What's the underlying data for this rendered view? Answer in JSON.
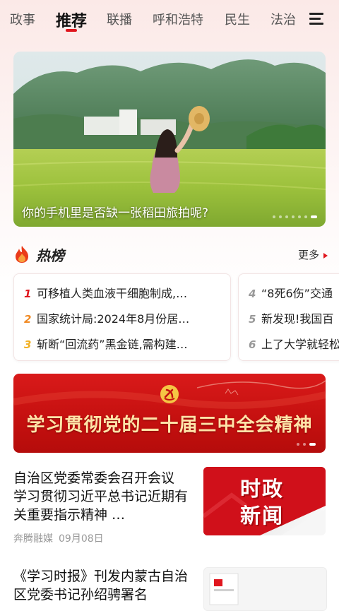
{
  "tabs": [
    {
      "label": "政事"
    },
    {
      "label": "推荐",
      "active": true
    },
    {
      "label": "联播"
    },
    {
      "label": "呼和浩特"
    },
    {
      "label": "民生"
    },
    {
      "label": "法治"
    }
  ],
  "menu_icon": "menu-icon",
  "banner": {
    "caption": "你的手机里是否缺一张稻田旅拍呢?",
    "slides": 7,
    "active_slide": 7
  },
  "hot": {
    "icon": "flame-icon",
    "title": "热榜",
    "more_label": "更多",
    "left_items": [
      {
        "rank": "1",
        "text": "可移植人类血液干细胞制成,…"
      },
      {
        "rank": "2",
        "text": "国家统计局:2024年8月份居…"
      },
      {
        "rank": "3",
        "text": "斩断“回流药”黑金链,需构建…"
      }
    ],
    "right_items": [
      {
        "rank": "4",
        "text": "“8死6伤”交通"
      },
      {
        "rank": "5",
        "text": "新发现!我国百"
      },
      {
        "rank": "6",
        "text": "上了大学就轻松"
      }
    ]
  },
  "study_banner": {
    "text": "学习贯彻党的二十届三中全会精神",
    "emblem": "party-emblem-icon"
  },
  "news": [
    {
      "title": "自治区党委常委会召开会议 学习贯彻习近平总书记近期有关重要指示精神 …",
      "source": "奔腾融媒",
      "date": "09月08日",
      "thumb_text_line1": "时政",
      "thumb_text_line2": "新闻"
    },
    {
      "title": "《学习时报》刊发内蒙古自治区党委书记孙绍骋署名"
    }
  ],
  "colors": {
    "accent": "#e0161e",
    "banner_red": "#c4100f",
    "gold_text": "#ffe3a8"
  }
}
